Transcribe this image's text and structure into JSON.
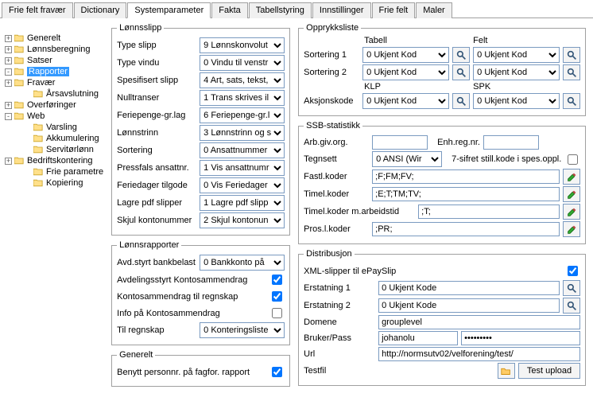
{
  "tabs": [
    "Frie felt fravær",
    "Dictionary",
    "Systemparameter",
    "Fakta",
    "Tabellstyring",
    "Innstillinger",
    "Frie felt",
    "Maler"
  ],
  "activeTab": 2,
  "tree": {
    "items": [
      {
        "label": "Generelt",
        "exp": "+",
        "child": false,
        "sel": false
      },
      {
        "label": "Lønnsberegning",
        "exp": "+",
        "child": false,
        "sel": false
      },
      {
        "label": "Satser",
        "exp": "+",
        "child": false,
        "sel": false
      },
      {
        "label": "Rapporter",
        "exp": "-",
        "child": false,
        "sel": true
      },
      {
        "label": "Fravær",
        "exp": "+",
        "child": false,
        "sel": false
      },
      {
        "label": "Årsavslutning",
        "exp": "",
        "child": true,
        "sel": false
      },
      {
        "label": "Overføringer",
        "exp": "+",
        "child": false,
        "sel": false
      },
      {
        "label": "Web",
        "exp": "-",
        "child": false,
        "sel": false
      },
      {
        "label": "Varsling",
        "exp": "",
        "child": true,
        "sel": false
      },
      {
        "label": "Akkumulering",
        "exp": "",
        "child": true,
        "sel": false
      },
      {
        "label": "Servitørlønn",
        "exp": "",
        "child": true,
        "sel": false
      },
      {
        "label": "Bedriftskontering",
        "exp": "+",
        "child": false,
        "sel": false
      },
      {
        "label": "Frie parametre",
        "exp": "",
        "child": true,
        "sel": false
      },
      {
        "label": "Kopiering",
        "exp": "",
        "child": true,
        "sel": false
      }
    ]
  },
  "lonnslipp": {
    "legend": "Lønnsslipp",
    "rows": [
      {
        "l": "Type slipp",
        "v": "9 Lønnskonvolut"
      },
      {
        "l": "Type vindu",
        "v": "0 Vindu til venstr"
      },
      {
        "l": "Spesifisert slipp",
        "v": "4 Art, sats, tekst,"
      },
      {
        "l": "Nulltranser",
        "v": "1 Trans skrives il"
      },
      {
        "l": "Feriepenge-gr.lag",
        "v": "6 Feriepenge-gr.l"
      },
      {
        "l": "Lønnstrinn",
        "v": "3 Lønnstrinn og s"
      },
      {
        "l": "Sortering",
        "v": "0 Ansattnummer"
      },
      {
        "l": "Pressfals ansattnr.",
        "v": "1 Vis ansattnumr"
      },
      {
        "l": "Feriedager tilgode",
        "v": "0 Vis Feriedager"
      },
      {
        "l": "Lagre pdf slipper",
        "v": "1 Lagre pdf slipp"
      },
      {
        "l": "Skjul kontonummer",
        "v": "2 Skjul kontonun"
      }
    ]
  },
  "lonnsrap": {
    "legend": "Lønnsrapporter",
    "avd": {
      "l": "Avd.styrt bankbelast",
      "v": "0 Bankkonto på"
    },
    "chk1": {
      "l": "Avdelingsstyrt Kontosammendrag",
      "c": true
    },
    "chk2": {
      "l": "Kontosammendrag til regnskap",
      "c": true
    },
    "chk3": {
      "l": "Info på Kontosammendrag",
      "c": false
    },
    "til": {
      "l": "Til regnskap",
      "v": "0 Konteringsliste"
    }
  },
  "generelt": {
    "legend": "Generelt",
    "chk": {
      "l": "Benytt personnr. på fagfor. rapport",
      "c": true
    }
  },
  "opprykk": {
    "legend": "Opprykksliste",
    "h1": "Tabell",
    "h2": "Felt",
    "r1": {
      "l": "Sortering 1",
      "v1": "0 Ukjent Kod",
      "v2": "0 Ukjent Kod"
    },
    "r2": {
      "l": "Sortering 2",
      "v1": "0 Ukjent Kod",
      "v2": "0 Ukjent Kod"
    },
    "h3": "KLP",
    "h4": "SPK",
    "r3": {
      "l": "Aksjonskode",
      "v1": "0 Ukjent Kod",
      "v2": "0 Ukjent Kod"
    }
  },
  "ssb": {
    "legend": "SSB-statistikk",
    "arb": {
      "l": "Arb.giv.org.",
      "v": ""
    },
    "enh": {
      "l": "Enh.reg.nr.",
      "v": ""
    },
    "tegn": {
      "l": "Tegnsett",
      "v": "0 ANSI (Wir"
    },
    "sifre": {
      "l": "7-sifret still.kode i spes.oppl.",
      "c": false
    },
    "fast": {
      "l": "Fastl.koder",
      "v": ";F;FM;FV;"
    },
    "timel": {
      "l": "Timel.koder",
      "v": ";E;T;TM;TV;"
    },
    "timela": {
      "l": "Timel.koder m.arbeidstid",
      "v": ";T;"
    },
    "pros": {
      "l": "Pros.l.koder",
      "v": ";PR;"
    }
  },
  "dist": {
    "legend": "Distribusjon",
    "xml": {
      "l": "XML-slipper til ePaySlip",
      "c": true
    },
    "e1": {
      "l": "Erstatning 1",
      "v": "0 Ukjent Kode"
    },
    "e2": {
      "l": "Erstatning 2",
      "v": "0 Ukjent Kode"
    },
    "dom": {
      "l": "Domene",
      "v": "grouplevel"
    },
    "bru": {
      "l": "Bruker/Pass",
      "v": "johanolu",
      "pw": "•••••••••"
    },
    "url": {
      "l": "Url",
      "v": "http://normsutv02/velforening/test/"
    },
    "test": {
      "l": "Testfil",
      "btn": "Test upload"
    }
  }
}
